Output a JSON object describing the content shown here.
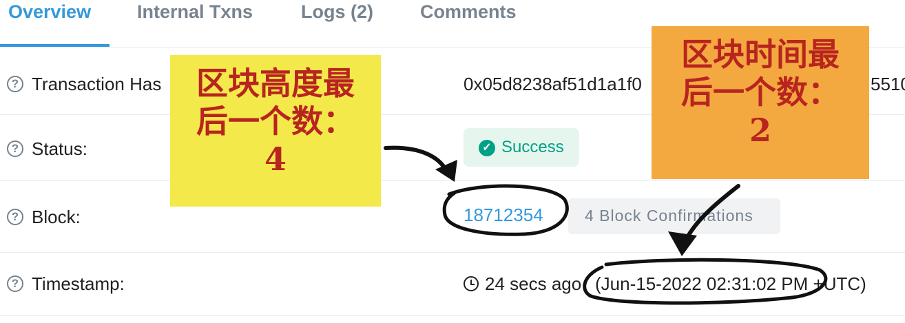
{
  "tabs": [
    {
      "label": "Overview",
      "active": true
    },
    {
      "label": "Internal Txns",
      "active": false
    },
    {
      "label": "Logs (2)",
      "active": false
    },
    {
      "label": "Comments",
      "active": false
    }
  ],
  "rows": {
    "hash": {
      "label": "Transaction Has",
      "value": "0x05d8238af51d1a1f0",
      "value_tail": "5510"
    },
    "status": {
      "label": "Status:",
      "value": "Success"
    },
    "block": {
      "label": "Block:",
      "value": "18712354",
      "confirmations": "4 Block Confirmations"
    },
    "timestamp": {
      "label": "Timestamp:",
      "relative": "24 secs ago",
      "absolute": "(Jun-15-2022 02:31:02 PM +UTC)"
    }
  },
  "annotations": {
    "yellow": {
      "line1": "区块高度最",
      "line2": "后一个数：",
      "line3": "4"
    },
    "orange": {
      "line1": "区块时间最",
      "line2": "后一个数：",
      "line3": "2"
    }
  },
  "colors": {
    "accent": "#3498db",
    "success": "#00a186",
    "note_yellow": "#f4e94a",
    "note_orange": "#f3a93f",
    "note_text": "#b8241f"
  },
  "icons": {
    "help": "question-circle-icon",
    "status": "check-circle-icon",
    "time": "clock-icon"
  }
}
